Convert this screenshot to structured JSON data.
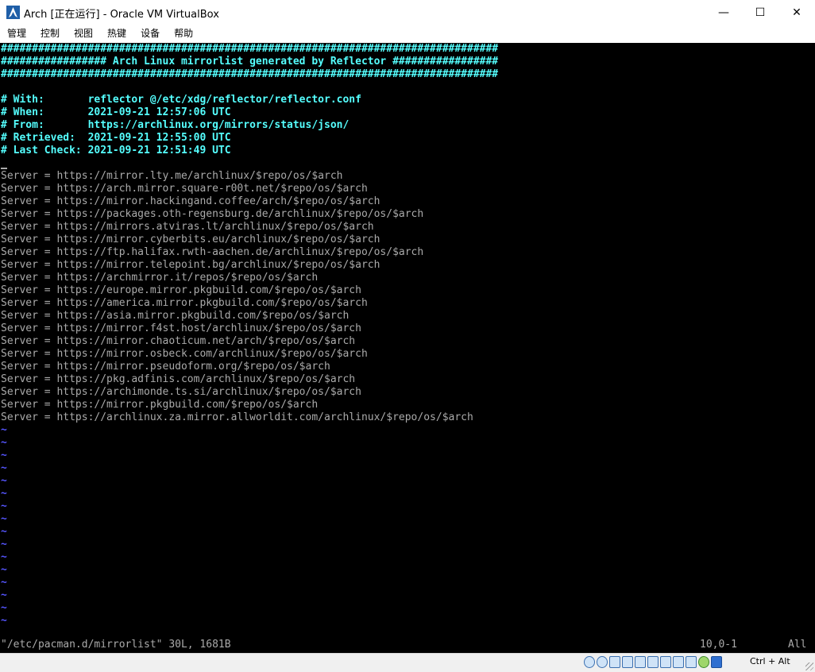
{
  "window": {
    "title": "Arch [正在运行] - Oracle VM VirtualBox",
    "minimize_glyph": "—",
    "maximize_glyph": "☐",
    "close_glyph": "✕"
  },
  "menu": [
    "管理",
    "控制",
    "视图",
    "热键",
    "设备",
    "帮助"
  ],
  "terminal": {
    "header_lines": [
      "################################################################################",
      "################# Arch Linux mirrorlist generated by Reflector #################",
      "################################################################################"
    ],
    "info_lines": [
      "# With:       reflector @/etc/xdg/reflector/reflector.conf",
      "# When:       2021-09-21 12:57:06 UTC",
      "# From:       https://archlinux.org/mirrors/status/json/",
      "# Retrieved:  2021-09-21 12:55:00 UTC",
      "# Last Check: 2021-09-21 12:51:49 UTC"
    ],
    "server_lines": [
      "Server = https://mirror.lty.me/archlinux/$repo/os/$arch",
      "Server = https://arch.mirror.square-r00t.net/$repo/os/$arch",
      "Server = https://mirror.hackingand.coffee/arch/$repo/os/$arch",
      "Server = https://packages.oth-regensburg.de/archlinux/$repo/os/$arch",
      "Server = https://mirrors.atviras.lt/archlinux/$repo/os/$arch",
      "Server = https://mirror.cyberbits.eu/archlinux/$repo/os/$arch",
      "Server = https://ftp.halifax.rwth-aachen.de/archlinux/$repo/os/$arch",
      "Server = https://mirror.telepoint.bg/archlinux/$repo/os/$arch",
      "Server = https://archmirror.it/repos/$repo/os/$arch",
      "Server = https://europe.mirror.pkgbuild.com/$repo/os/$arch",
      "Server = https://america.mirror.pkgbuild.com/$repo/os/$arch",
      "Server = https://asia.mirror.pkgbuild.com/$repo/os/$arch",
      "Server = https://mirror.f4st.host/archlinux/$repo/os/$arch",
      "Server = https://mirror.chaoticum.net/arch/$repo/os/$arch",
      "Server = https://mirror.osbeck.com/archlinux/$repo/os/$arch",
      "Server = https://mirror.pseudoform.org/$repo/os/$arch",
      "Server = https://pkg.adfinis.com/archlinux/$repo/os/$arch",
      "Server = https://archimonde.ts.si/archlinux/$repo/os/$arch",
      "Server = https://mirror.pkgbuild.com/$repo/os/$arch",
      "Server = https://archlinux.za.mirror.allworldit.com/archlinux/$repo/os/$arch"
    ],
    "tilde_glyph": "~",
    "status": {
      "file": "\"/etc/pacman.d/mirrorlist\" 30L, 1681B",
      "position": "10,0-1",
      "scroll": "All"
    }
  },
  "statusbar": {
    "host_key": "Ctrl + Alt"
  }
}
